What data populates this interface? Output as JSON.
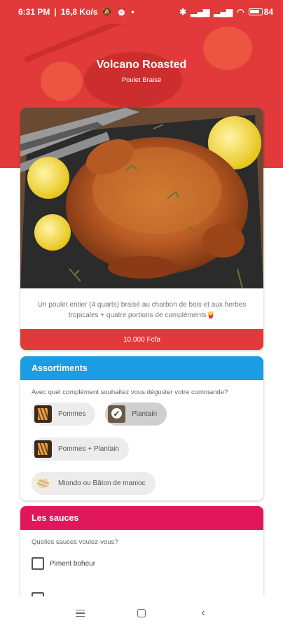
{
  "status_bar": {
    "time": "6:31 PM",
    "network_speed": "16,8 Ko/s",
    "battery": "84"
  },
  "header": {
    "title": "Volcano Roasted",
    "subtitle": "Poulet Braisé"
  },
  "product": {
    "description": "Un poulet entier (4 quarts) braisé au charbon de bois et aux herbes tropicales + quatre portions de compléments🍟",
    "price": "10.000 Fcfa"
  },
  "assortments": {
    "title": "Assortiments",
    "question": "Avec quel complément souhaitez vous déguster votre commande?",
    "options": [
      {
        "label": "Pommes",
        "selected": false
      },
      {
        "label": "Plantain",
        "selected": true
      },
      {
        "label": "Pommes + Plantain",
        "selected": false
      },
      {
        "label": "Miondo ou Bâton de manioc",
        "selected": false
      }
    ]
  },
  "sauces": {
    "title": "Les sauces",
    "question": "Quelles sauces voulez-vous?",
    "options": [
      {
        "label": "Piment boheur",
        "checked": false
      }
    ]
  },
  "colors": {
    "primary_red": "#e23a3a",
    "assort_blue": "#1a9de2",
    "sauces_pink": "#e0175b"
  }
}
